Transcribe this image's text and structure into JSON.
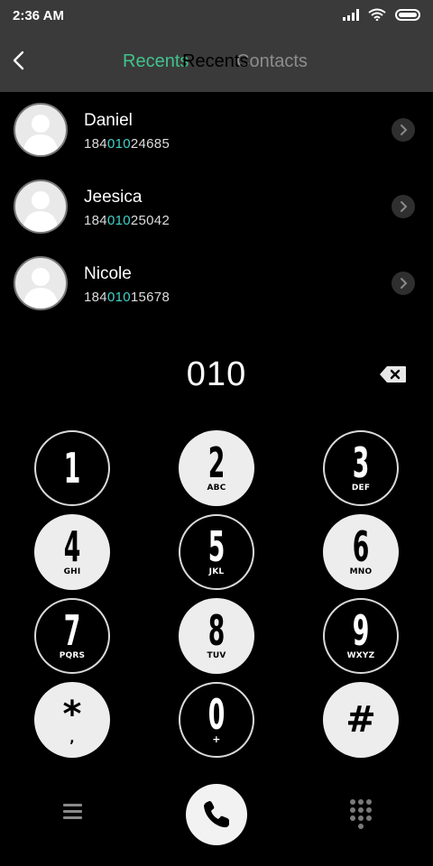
{
  "status_bar": {
    "time": "2:36 AM"
  },
  "header": {
    "tabs": [
      {
        "label": "Recents"
      },
      {
        "label": "Recents"
      },
      {
        "label": "Contacts"
      }
    ]
  },
  "contacts": [
    {
      "name": "Daniel",
      "number_prefix": "184",
      "number_match": "010",
      "number_suffix": "24685"
    },
    {
      "name": "Jeesica",
      "number_prefix": "184",
      "number_match": "010",
      "number_suffix": "25042"
    },
    {
      "name": "Nicole",
      "number_prefix": "184",
      "number_match": "010",
      "number_suffix": "15678"
    }
  ],
  "dialer": {
    "value": "010",
    "keys": [
      {
        "digit": "1",
        "letters": ""
      },
      {
        "digit": "2",
        "letters": "ABC"
      },
      {
        "digit": "3",
        "letters": "DEF"
      },
      {
        "digit": "4",
        "letters": "GHI"
      },
      {
        "digit": "5",
        "letters": "JKL"
      },
      {
        "digit": "6",
        "letters": "MNO"
      },
      {
        "digit": "7",
        "letters": "PQRS"
      },
      {
        "digit": "8",
        "letters": "TUV"
      },
      {
        "digit": "9",
        "letters": "WXYZ"
      },
      {
        "digit": "*",
        "letters": ","
      },
      {
        "digit": "0",
        "letters": "+"
      },
      {
        "digit": "#",
        "letters": ""
      }
    ]
  },
  "colors": {
    "accent_green": "#41c38c",
    "match_highlight": "#3fd3c8",
    "header_bg": "#3a3a3a"
  },
  "icons": {
    "back": "chevron-left-icon",
    "backspace": "backspace-icon",
    "menu": "hamburger-menu-icon",
    "call": "phone-icon",
    "keypad": "dialpad-icon",
    "avatar": "person-silhouette-icon",
    "row_action": "chevron-right-icon"
  }
}
